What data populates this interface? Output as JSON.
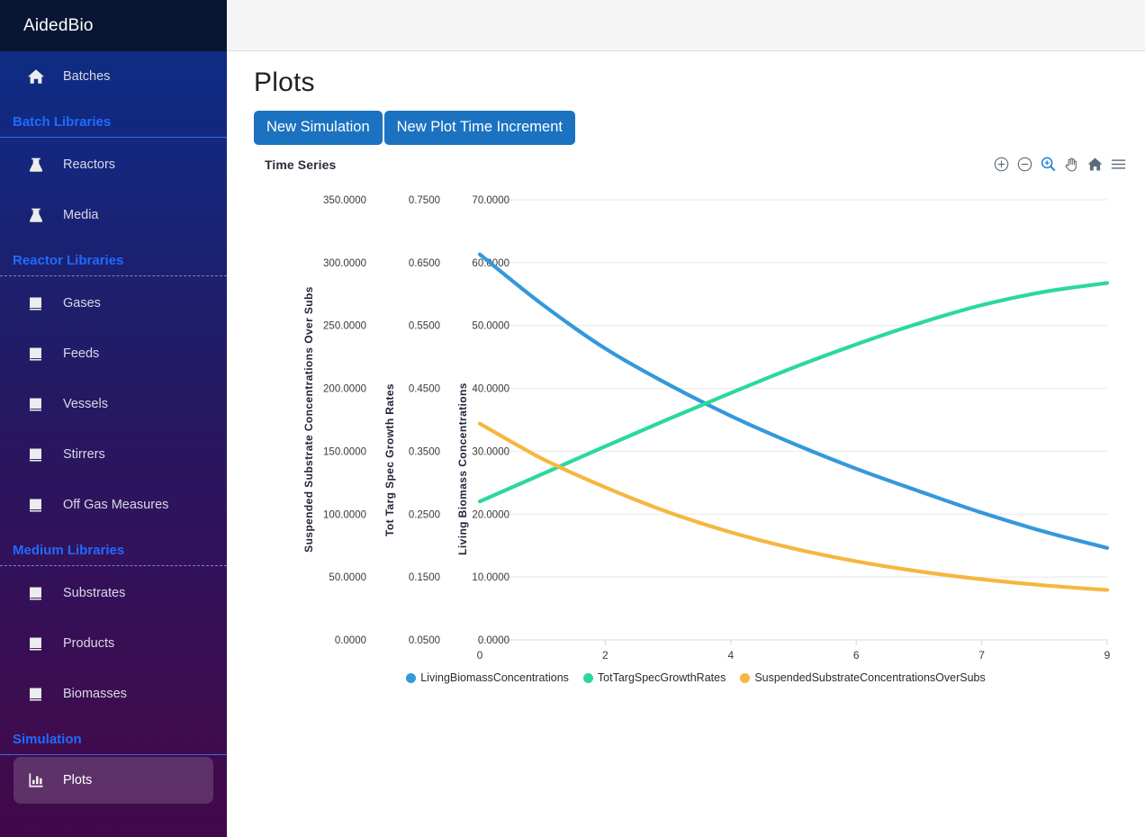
{
  "app": {
    "brand": "AidedBio"
  },
  "sidebar": {
    "items": [
      {
        "label": "Batches",
        "icon": "home-icon",
        "type": "item",
        "active": false
      },
      {
        "label": "Batch Libraries",
        "type": "section",
        "separator": "solid"
      },
      {
        "label": "Reactors",
        "icon": "flask-icon",
        "type": "item",
        "active": false
      },
      {
        "label": "Media",
        "icon": "flask-icon",
        "type": "item",
        "active": false
      },
      {
        "label": "Reactor Libraries",
        "type": "section",
        "separator": "dashed"
      },
      {
        "label": "Gases",
        "icon": "book-icon",
        "type": "item",
        "active": false
      },
      {
        "label": "Feeds",
        "icon": "book-icon",
        "type": "item",
        "active": false
      },
      {
        "label": "Vessels",
        "icon": "book-icon",
        "type": "item",
        "active": false
      },
      {
        "label": "Stirrers",
        "icon": "book-icon",
        "type": "item",
        "active": false
      },
      {
        "label": "Off Gas Measures",
        "icon": "book-icon",
        "type": "item",
        "active": false
      },
      {
        "label": "Medium Libraries",
        "type": "section",
        "separator": "dashed"
      },
      {
        "label": "Substrates",
        "icon": "book-icon",
        "type": "item",
        "active": false
      },
      {
        "label": "Products",
        "icon": "book-icon",
        "type": "item",
        "active": false
      },
      {
        "label": "Biomasses",
        "icon": "book-icon",
        "type": "item",
        "active": false
      },
      {
        "label": "Simulation",
        "type": "section",
        "separator": "solid"
      },
      {
        "label": "Plots",
        "icon": "bar-chart-icon",
        "type": "item",
        "active": true
      }
    ]
  },
  "page": {
    "title": "Plots",
    "buttons": [
      {
        "label": "New Simulation",
        "name": "new-simulation-button"
      },
      {
        "label": "New Plot Time Increment",
        "name": "new-plot-time-increment-button"
      }
    ]
  },
  "plot_toolbar": {
    "items": [
      {
        "name": "zoom-in-icon",
        "selected": false
      },
      {
        "name": "zoom-out-icon",
        "selected": false
      },
      {
        "name": "zoom-select-icon",
        "selected": true
      },
      {
        "name": "pan-hand-icon",
        "selected": false
      },
      {
        "name": "home-reset-icon",
        "selected": false
      },
      {
        "name": "menu-hamburger-icon",
        "selected": false
      }
    ]
  },
  "chart_data": {
    "type": "line",
    "title": "Time Series",
    "xlabel": "",
    "grid": true,
    "legend_position": "bottom",
    "x_ticks": [
      "0",
      "2",
      "4",
      "6",
      "7",
      "9"
    ],
    "x": [
      0,
      1.8,
      3.6,
      5.4,
      7.2,
      9
    ],
    "xlim": [
      0,
      9
    ],
    "axes": [
      {
        "name": "suspended-substrate-axis",
        "title": "Suspended Substrate Concentrations Over Subs",
        "ticks": [
          "350.0000",
          "300.0000",
          "250.0000",
          "200.0000",
          "150.0000",
          "100.0000",
          "50.0000",
          "0.0000"
        ],
        "ylim": [
          0,
          350
        ]
      },
      {
        "name": "tot-targ-spec-growth-rates-axis",
        "title": "Tot Targ Spec Growth Rates",
        "ticks": [
          "0.7500",
          "0.6500",
          "0.5500",
          "0.4500",
          "0.3500",
          "0.2500",
          "0.1500",
          "0.0500"
        ],
        "ylim": [
          0.05,
          0.75
        ]
      },
      {
        "name": "living-biomass-axis",
        "title": "Living Biomass Concentrations",
        "ticks": [
          "70.0000",
          "60.0000",
          "50.0000",
          "40.0000",
          "30.0000",
          "20.0000",
          "10.0000",
          "0.0000"
        ],
        "ylim": [
          0,
          70
        ]
      }
    ],
    "series": [
      {
        "name": "LivingBiomassConcentrations",
        "color": "#3498db",
        "axis": "living-biomass-axis",
        "x": [
          0,
          0.9,
          1.8,
          2.7,
          3.6,
          4.5,
          5.4,
          6.3,
          7.2,
          8.1,
          9
        ],
        "values": [
          60.0,
          52.0,
          45.0,
          39.3,
          34.2,
          29.8,
          25.8,
          22.2,
          18.8,
          15.8,
          13.2
        ],
        "plot_y_fraction": [
          0.124,
          0.238,
          0.338,
          0.419,
          0.491,
          0.554,
          0.611,
          0.662,
          0.711,
          0.754,
          0.791
        ]
      },
      {
        "name": "TotTargSpecGrowthRates",
        "color": "#2bd99a",
        "axis": "tot-targ-spec-growth-rates-axis",
        "x": [
          0,
          0.9,
          1.8,
          2.7,
          3.6,
          4.5,
          5.4,
          6.3,
          7.2,
          8.1,
          9
        ],
        "values": [
          0.275,
          0.313,
          0.351,
          0.388,
          0.424,
          0.459,
          0.491,
          0.52,
          0.545,
          0.563,
          0.575
        ],
        "plot_y_fraction": [
          0.6855,
          0.6229,
          0.5602,
          0.4985,
          0.4391,
          0.3813,
          0.3284,
          0.2806,
          0.2393,
          0.209,
          0.189
        ]
      },
      {
        "name": "SuspendedSubstrateConcentrationsOverSubs",
        "color": "#f5b740",
        "axis": "suspended-substrate-axis",
        "x": [
          0,
          0.9,
          1.8,
          2.7,
          3.6,
          4.5,
          5.4,
          6.3,
          7.2,
          8.1,
          9
        ],
        "values": [
          172.0,
          136.0,
          106.0,
          81.0,
          61.0,
          45.0,
          33.0,
          23.5,
          16.5,
          11.0,
          7.0
        ],
        "plot_y_fraction": [
          0.5085,
          0.5888,
          0.6533,
          0.7096,
          0.7554,
          0.7923,
          0.8215,
          0.8443,
          0.8622,
          0.8761,
          0.8866
        ]
      }
    ]
  },
  "legend": {
    "items": [
      {
        "label": "LivingBiomassConcentrations",
        "color": "#3498db"
      },
      {
        "label": "TotTargSpecGrowthRates",
        "color": "#2bd99a"
      },
      {
        "label": "SuspendedSubstrateConcentrationsOverSubs",
        "color": "#f5b740"
      }
    ]
  }
}
